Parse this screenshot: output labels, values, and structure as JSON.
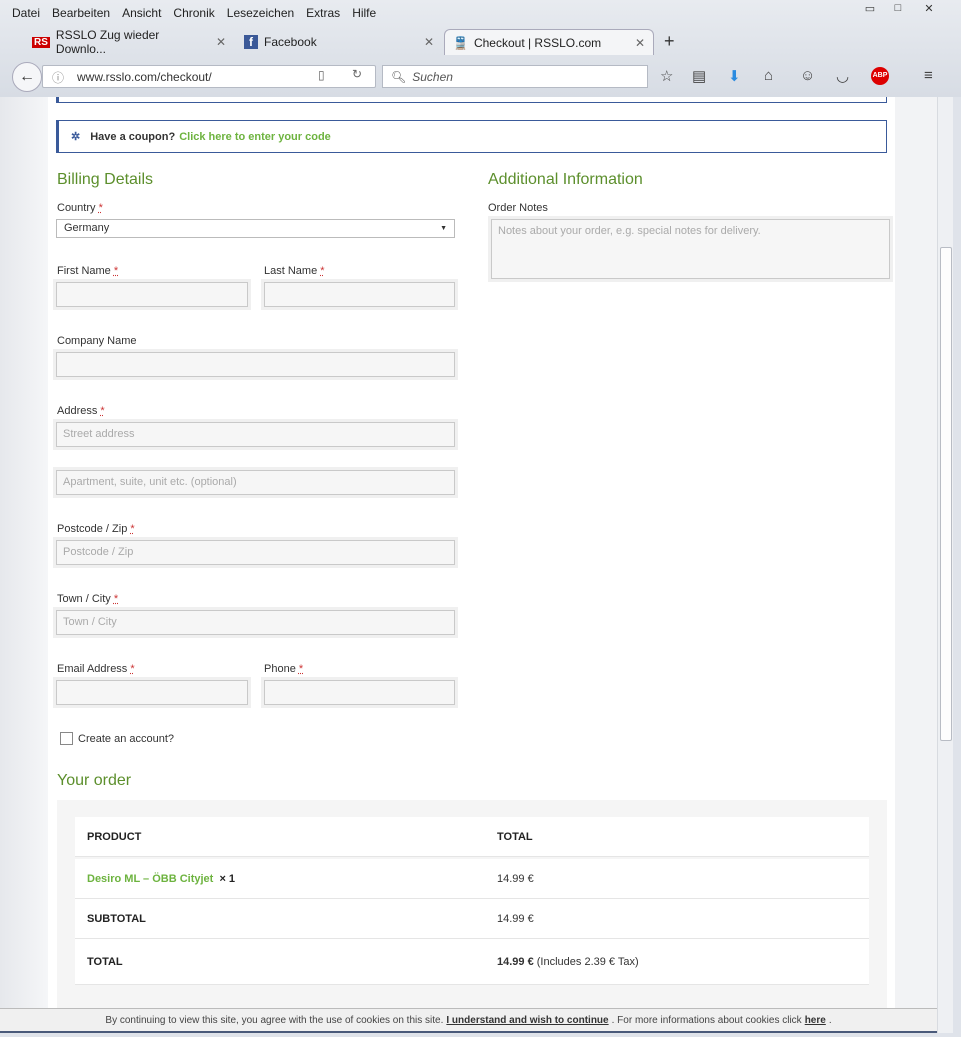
{
  "browser": {
    "menu": [
      "Datei",
      "Bearbeiten",
      "Ansicht",
      "Chronik",
      "Lesezeichen",
      "Extras",
      "Hilfe"
    ],
    "tabs": [
      {
        "label": "RSSLO Zug wieder Downlo...",
        "icon": "RS"
      },
      {
        "label": "Facebook",
        "icon": "f"
      },
      {
        "label": "Checkout | RSSLO.com",
        "icon": "train"
      }
    ],
    "url": "www.rsslo.com/checkout/",
    "search_placeholder": "Suchen",
    "abp": "ABP"
  },
  "coupon": {
    "text": "Have a coupon?",
    "link": "Click here to enter your code"
  },
  "billing": {
    "title": "Billing Details",
    "country_label": "Country",
    "country_value": "Germany",
    "first_name": "First Name",
    "last_name": "Last Name",
    "company": "Company Name",
    "address": "Address",
    "street_ph": "Street address",
    "apt_ph": "Apartment, suite, unit etc. (optional)",
    "postcode": "Postcode / Zip",
    "postcode_ph": "Postcode / Zip",
    "city": "Town / City",
    "city_ph": "Town / City",
    "email": "Email Address",
    "phone": "Phone",
    "create_account": "Create an account?",
    "req": "*"
  },
  "additional": {
    "title": "Additional Information",
    "notes_label": "Order Notes",
    "notes_ph": "Notes about your order, e.g. special notes for delivery."
  },
  "order": {
    "title": "Your order",
    "col_product": "PRODUCT",
    "col_total": "TOTAL",
    "item": "Desiro ML – ÖBB Cityjet",
    "qty": "× 1",
    "item_total": "14.99 €",
    "subtotal_label": "SUBTOTAL",
    "subtotal": "14.99 €",
    "total_label": "TOTAL",
    "total": "14.99 €",
    "tax": "(Includes 2.39 € Tax)"
  },
  "cookie": {
    "text": "By continuing to view this site, you agree with the use of cookies on this site.",
    "accept": "I understand and wish to continue",
    "more": ". For more informations about cookies click",
    "here": "here",
    "end": "."
  }
}
